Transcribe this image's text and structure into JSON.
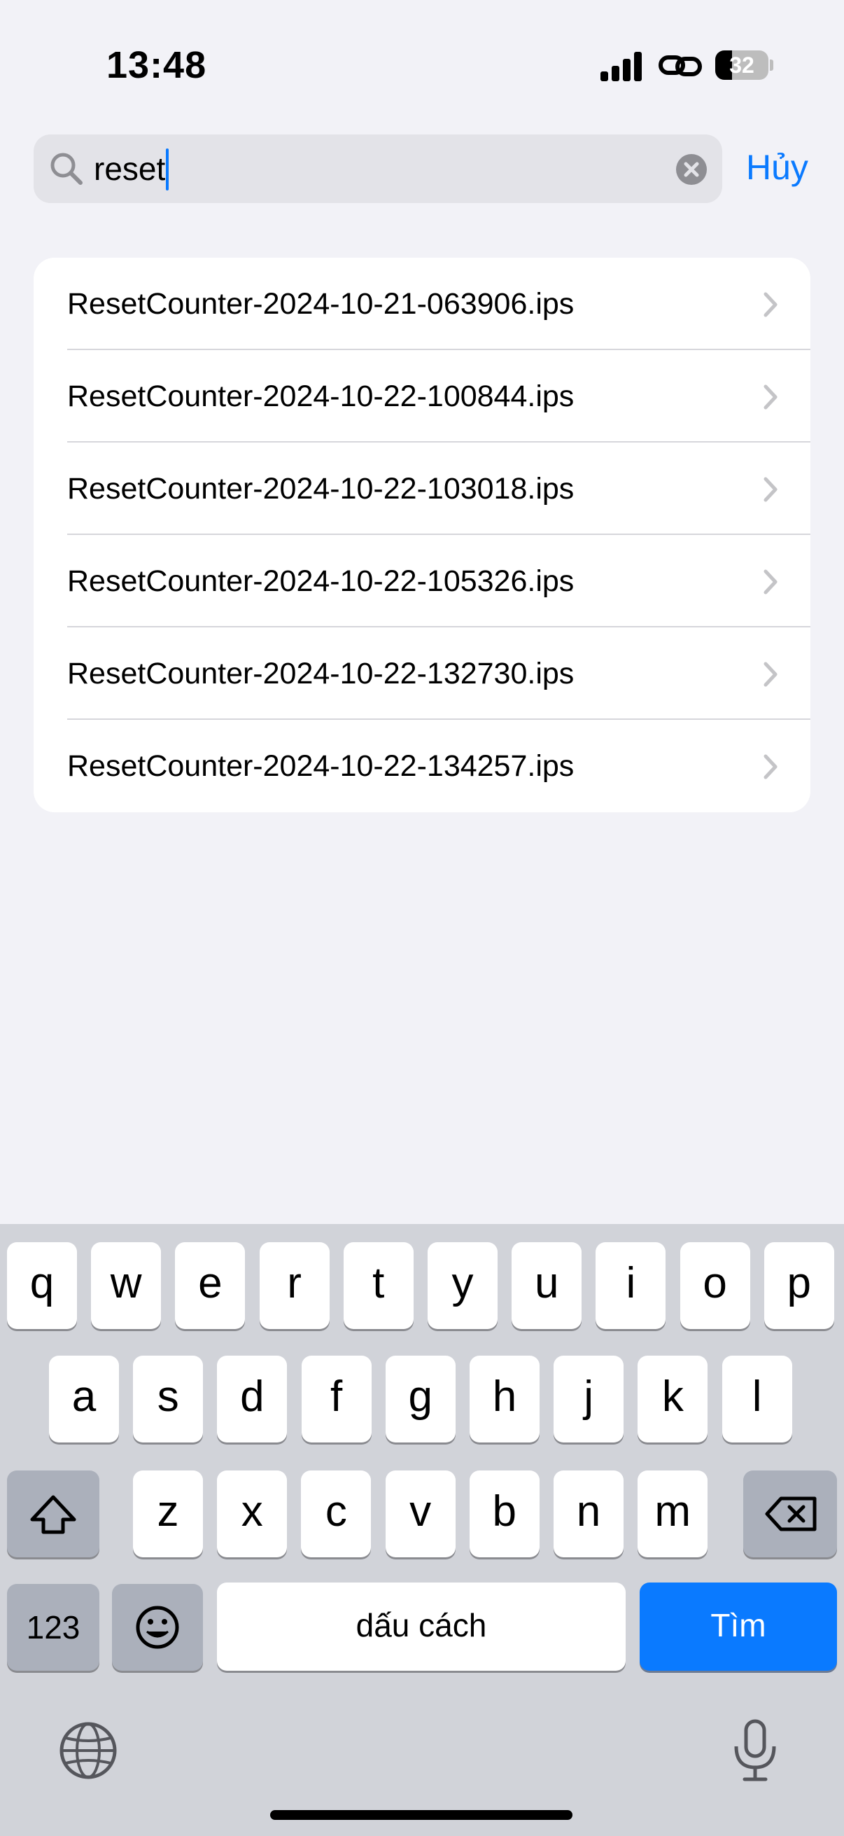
{
  "status": {
    "time": "13:48",
    "battery": "32",
    "battery_level": 0.32
  },
  "search": {
    "value": "reset",
    "cancel_label": "Hủy"
  },
  "results": [
    "ResetCounter-2024-10-21-063906.ips",
    "ResetCounter-2024-10-22-100844.ips",
    "ResetCounter-2024-10-22-103018.ips",
    "ResetCounter-2024-10-22-105326.ips",
    "ResetCounter-2024-10-22-132730.ips",
    "ResetCounter-2024-10-22-134257.ips"
  ],
  "keyboard": {
    "row1": [
      "q",
      "w",
      "e",
      "r",
      "t",
      "y",
      "u",
      "i",
      "o",
      "p"
    ],
    "row2": [
      "a",
      "s",
      "d",
      "f",
      "g",
      "h",
      "j",
      "k",
      "l"
    ],
    "row3": [
      "z",
      "x",
      "c",
      "v",
      "b",
      "n",
      "m"
    ],
    "numbers_label": "123",
    "space_label": "dấu cách",
    "search_label": "Tìm"
  },
  "colors": {
    "accent": "#0a7aff",
    "background": "#f2f2f7",
    "keyboard_bg": "#d1d3d9"
  }
}
